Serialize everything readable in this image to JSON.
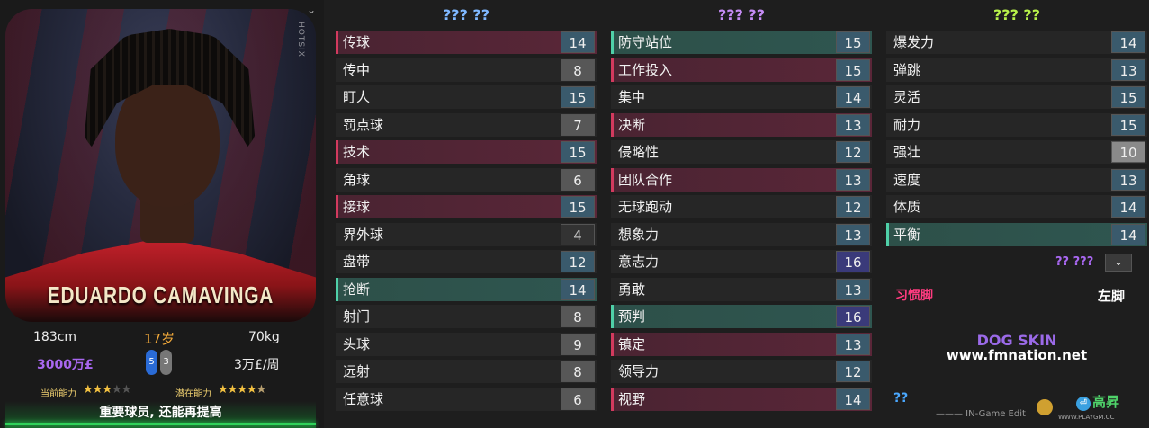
{
  "player": {
    "name": "EDUARDO CAMAVINGA",
    "height": "183cm",
    "age": "17岁",
    "weight": "70kg",
    "value": "3000万£",
    "wage": "3万£/周",
    "foot_left": "5",
    "foot_right": "3",
    "current_ability_label": "当前能力",
    "potential_ability_label": "潜在能力",
    "current_ability_stars": 3,
    "potential_ability_stars": 4.5,
    "summary": "重要球员, 还能再提高",
    "footnote": "… … ",
    "photo_brand": "HOTSIX"
  },
  "columns": {
    "technical": {
      "title": "??? ??",
      "attrs": [
        {
          "name": "传球",
          "value": "14",
          "hl": "red",
          "style": "blue"
        },
        {
          "name": "传中",
          "value": "8",
          "hl": "",
          "style": "gray"
        },
        {
          "name": "盯人",
          "value": "15",
          "hl": "",
          "style": "blue"
        },
        {
          "name": "罚点球",
          "value": "7",
          "hl": "",
          "style": "gray"
        },
        {
          "name": "技术",
          "value": "15",
          "hl": "red",
          "style": "blue"
        },
        {
          "name": "角球",
          "value": "6",
          "hl": "",
          "style": "gray"
        },
        {
          "name": "接球",
          "value": "15",
          "hl": "red",
          "style": "blue"
        },
        {
          "name": "界外球",
          "value": "4",
          "hl": "",
          "style": "dark"
        },
        {
          "name": "盘带",
          "value": "12",
          "hl": "",
          "style": "blue"
        },
        {
          "name": "抢断",
          "value": "14",
          "hl": "teal",
          "style": "blue"
        },
        {
          "name": "射门",
          "value": "8",
          "hl": "",
          "style": "gray"
        },
        {
          "name": "头球",
          "value": "9",
          "hl": "",
          "style": "gray"
        },
        {
          "name": "远射",
          "value": "8",
          "hl": "",
          "style": "gray"
        },
        {
          "name": "任意球",
          "value": "6",
          "hl": "",
          "style": "gray"
        }
      ]
    },
    "mental": {
      "title": "??? ??",
      "attrs": [
        {
          "name": "防守站位",
          "value": "15",
          "hl": "teal",
          "style": "blue"
        },
        {
          "name": "工作投入",
          "value": "15",
          "hl": "red",
          "style": "blue"
        },
        {
          "name": "集中",
          "value": "14",
          "hl": "",
          "style": "blue"
        },
        {
          "name": "决断",
          "value": "13",
          "hl": "red",
          "style": "blue"
        },
        {
          "name": "侵略性",
          "value": "12",
          "hl": "",
          "style": "blue"
        },
        {
          "name": "团队合作",
          "value": "13",
          "hl": "red",
          "style": "blue"
        },
        {
          "name": "无球跑动",
          "value": "12",
          "hl": "",
          "style": "blue"
        },
        {
          "name": "想象力",
          "value": "13",
          "hl": "",
          "style": "blue"
        },
        {
          "name": "意志力",
          "value": "16",
          "hl": "",
          "style": "purple"
        },
        {
          "name": "勇敢",
          "value": "13",
          "hl": "",
          "style": "blue"
        },
        {
          "name": "预判",
          "value": "16",
          "hl": "teal",
          "style": "purple"
        },
        {
          "name": "镇定",
          "value": "13",
          "hl": "red",
          "style": "blue"
        },
        {
          "name": "领导力",
          "value": "12",
          "hl": "",
          "style": "blue"
        },
        {
          "name": "视野",
          "value": "14",
          "hl": "red",
          "style": "blue"
        }
      ]
    },
    "physical": {
      "title": "??? ??",
      "attrs": [
        {
          "name": "爆发力",
          "value": "14",
          "hl": "",
          "style": "blue"
        },
        {
          "name": "弹跳",
          "value": "13",
          "hl": "",
          "style": "blue"
        },
        {
          "name": "灵活",
          "value": "15",
          "hl": "",
          "style": "blue"
        },
        {
          "name": "耐力",
          "value": "15",
          "hl": "",
          "style": "blue"
        },
        {
          "name": "强壮",
          "value": "10",
          "hl": "",
          "style": "lgray"
        },
        {
          "name": "速度",
          "value": "13",
          "hl": "",
          "style": "blue"
        },
        {
          "name": "体质",
          "value": "14",
          "hl": "",
          "style": "blue"
        },
        {
          "name": "平衡",
          "value": "14",
          "hl": "teal",
          "style": "blue"
        }
      ]
    }
  },
  "extras": {
    "more_label": "?? ???",
    "more_button": "⌄",
    "foot_label": "习惯脚",
    "foot_value": "左脚",
    "skin_title": "DOG SKIN",
    "skin_url": "www.fmnation.net",
    "hint": "??",
    "editor_tag": "——— IN-Game Edit",
    "highlight_label": "高昇",
    "watermark_site": "WWW.PLAYGM.CC"
  }
}
